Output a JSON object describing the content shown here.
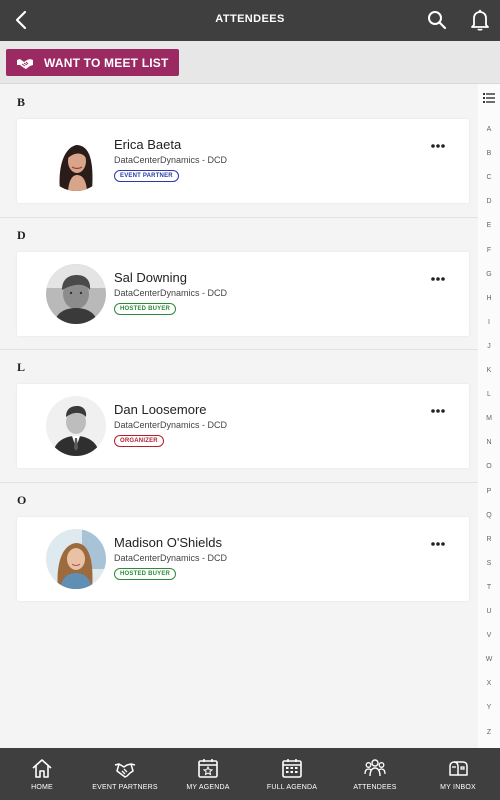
{
  "header": {
    "title": "ATTENDEES",
    "back_icon": "back-arrow-icon",
    "search_icon": "search-icon",
    "bell_icon": "bell-icon"
  },
  "action": {
    "meet_list_label": "WANT TO MEET LIST",
    "icon": "handshake-icon",
    "color": "#9b2a62"
  },
  "sections": [
    {
      "letter": "B",
      "attendees": [
        {
          "name": "Erica Baeta",
          "company": "DataCenterDynamics - DCD",
          "badge": "EVENT PARTNER",
          "badge_type": "partner"
        }
      ]
    },
    {
      "letter": "D",
      "attendees": [
        {
          "name": "Sal Downing",
          "company": "DataCenterDynamics - DCD",
          "badge": "HOSTED BUYER",
          "badge_type": "buyer"
        }
      ]
    },
    {
      "letter": "L",
      "attendees": [
        {
          "name": "Dan Loosemore",
          "company": "DataCenterDynamics - DCD",
          "badge": "ORGANIZER",
          "badge_type": "organizer"
        }
      ]
    },
    {
      "letter": "O",
      "attendees": [
        {
          "name": "Madison O'Shields",
          "company": "DataCenterDynamics - DCD",
          "badge": "HOSTED BUYER",
          "badge_type": "buyer"
        }
      ]
    }
  ],
  "alphabet_index": [
    "A",
    "B",
    "C",
    "D",
    "E",
    "F",
    "G",
    "H",
    "I",
    "J",
    "K",
    "L",
    "M",
    "N",
    "O",
    "P",
    "Q",
    "R",
    "S",
    "T",
    "U",
    "V",
    "W",
    "X",
    "Y",
    "Z"
  ],
  "bottom_nav": [
    {
      "label": "HOME",
      "icon": "home-icon"
    },
    {
      "label": "EVENT PARTNERS",
      "icon": "handshake-icon"
    },
    {
      "label": "MY AGENDA",
      "icon": "calendar-star-icon"
    },
    {
      "label": "FULL AGENDA",
      "icon": "calendar-grid-icon"
    },
    {
      "label": "ATTENDEES",
      "icon": "people-icon"
    },
    {
      "label": "MY INBOX",
      "icon": "mailbox-icon"
    }
  ],
  "colors": {
    "topbar": "#3f3f3f",
    "accent": "#9b2a62",
    "badge_partner": "#2a3aa8",
    "badge_buyer": "#2c8a3a",
    "badge_organizer": "#b3202d"
  }
}
